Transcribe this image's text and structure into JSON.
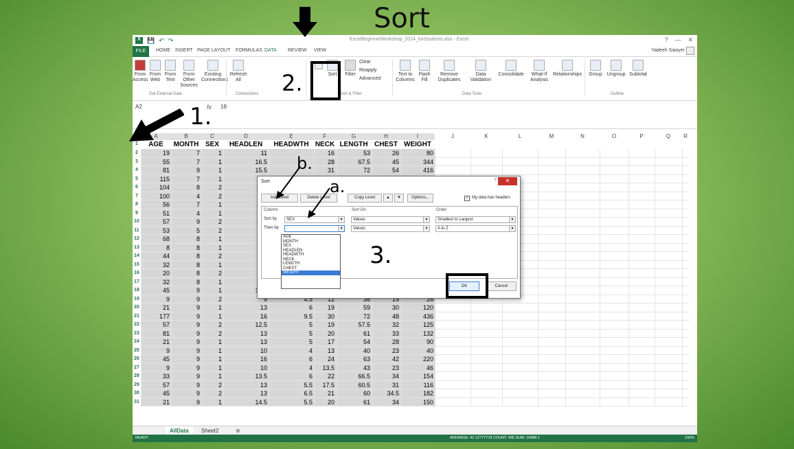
{
  "slide": {
    "title": "Sort"
  },
  "excel": {
    "title": "ExcelBeginnerWorkshop_2014_forStudents.xlsx - Excel",
    "user": "Yadeeh Sawyer",
    "tabs": [
      "FILE",
      "HOME",
      "INSERT",
      "PAGE LAYOUT",
      "FORMULAS",
      "DATA",
      "REVIEW",
      "VIEW"
    ],
    "ribbon": {
      "from_access": "From Access",
      "from_web": "From Web",
      "from_text": "From Text",
      "from_other": "From Other Sources",
      "existing": "Existing Connections",
      "refresh": "Refresh All",
      "sort": "Sort",
      "filter": "Filter",
      "clear": "Clear",
      "reapply": "Reapply",
      "advanced": "Advanced",
      "text_to_columns": "Text to Columns",
      "flash_fill": "Flash Fill",
      "remove_dup": "Remove Duplicates",
      "data_validation": "Data Validation",
      "consolidate": "Consolidate",
      "whatif": "What-If Analysis",
      "relationships": "Relationships",
      "group": "Group",
      "ungroup": "Ungroup",
      "subtotal": "Subtotal",
      "grp_external": "Get External Data",
      "grp_connections": "Connections",
      "grp_sort": "Sort & Filter",
      "grp_tools": "Data Tools",
      "grp_outline": "Outline"
    },
    "namebox": "A2",
    "fx": "fx",
    "formula": "19",
    "columns": [
      "A",
      "B",
      "C",
      "D",
      "E",
      "F",
      "G",
      "H",
      "I",
      "J",
      "K",
      "L",
      "M",
      "N",
      "O",
      "P",
      "Q",
      "R"
    ],
    "headers": [
      "AGE",
      "MONTH",
      "SEX",
      "HEADLEN",
      "HEADWTH",
      "NECK",
      "LENGTH",
      "CHEST",
      "WEIGHT"
    ],
    "rows": [
      [
        "19",
        "7",
        "1",
        "11",
        "",
        "16",
        "53",
        "26",
        "80"
      ],
      [
        "55",
        "7",
        "1",
        "16.5",
        "",
        "28",
        "67.5",
        "45",
        "344"
      ],
      [
        "81",
        "9",
        "1",
        "15.5",
        "",
        "31",
        "72",
        "54",
        "416"
      ],
      [
        "115",
        "7",
        "1",
        "",
        "",
        "",
        "",
        "",
        ""
      ],
      [
        "104",
        "8",
        "2",
        "15",
        "",
        "",
        "",
        "",
        ""
      ],
      [
        "100",
        "4",
        "2",
        "",
        "",
        "",
        "",
        "",
        ""
      ],
      [
        "56",
        "7",
        "1",
        "",
        "",
        "",
        "",
        "",
        ""
      ],
      [
        "51",
        "4",
        "1",
        "13",
        "",
        "",
        "",
        "",
        ""
      ],
      [
        "57",
        "9",
        "2",
        "13",
        "",
        "",
        "",
        "",
        ""
      ],
      [
        "53",
        "5",
        "2",
        "12",
        "",
        "",
        "",
        "",
        ""
      ],
      [
        "68",
        "8",
        "1",
        "",
        "",
        "",
        "",
        "",
        ""
      ],
      [
        "8",
        "8",
        "1",
        "",
        "",
        "",
        "",
        "",
        ""
      ],
      [
        "44",
        "8",
        "2",
        "12",
        "",
        "",
        "",
        "",
        ""
      ],
      [
        "32",
        "8",
        "1",
        "",
        "",
        "",
        "",
        "",
        ""
      ],
      [
        "20",
        "8",
        "2",
        "11",
        "",
        "",
        "",
        "",
        ""
      ],
      [
        "32",
        "8",
        "1",
        "",
        "",
        "",
        "",
        "",
        ""
      ],
      [
        "45",
        "9",
        "1",
        "13.5",
        "7",
        "24",
        "64",
        "39",
        "204"
      ],
      [
        "9",
        "9",
        "2",
        "9",
        "4.5",
        "12",
        "36",
        "19",
        "26"
      ],
      [
        "21",
        "9",
        "1",
        "13",
        "6",
        "19",
        "59",
        "30",
        "120"
      ],
      [
        "177",
        "9",
        "1",
        "16",
        "9.5",
        "30",
        "72",
        "48",
        "436"
      ],
      [
        "57",
        "9",
        "2",
        "12.5",
        "5",
        "19",
        "57.5",
        "32",
        "125"
      ],
      [
        "81",
        "9",
        "2",
        "13",
        "5",
        "20",
        "61",
        "33",
        "132"
      ],
      [
        "21",
        "9",
        "1",
        "13",
        "5",
        "17",
        "54",
        "28",
        "90"
      ],
      [
        "9",
        "9",
        "1",
        "10",
        "4",
        "13",
        "40",
        "23",
        "40"
      ],
      [
        "45",
        "9",
        "1",
        "16",
        "6",
        "24",
        "63",
        "42",
        "220"
      ],
      [
        "9",
        "9",
        "1",
        "10",
        "4",
        "13.5",
        "43",
        "23",
        "46"
      ],
      [
        "33",
        "9",
        "1",
        "13.5",
        "6",
        "22",
        "66.5",
        "34",
        "154"
      ],
      [
        "57",
        "9",
        "2",
        "13",
        "5.5",
        "17.5",
        "60.5",
        "31",
        "116"
      ],
      [
        "45",
        "9",
        "2",
        "13",
        "6.5",
        "21",
        "60",
        "34.5",
        "182"
      ],
      [
        "21",
        "9",
        "1",
        "14.5",
        "5.5",
        "20",
        "61",
        "34",
        "150"
      ]
    ],
    "sheets": [
      "AllData",
      "Sheet2"
    ],
    "status": {
      "ready": "READY",
      "summary": "AVERAGE: 41.12777778    COUNT: 495    SUM: 19988.1",
      "zoom": "100%"
    }
  },
  "dialog": {
    "title": "Sort",
    "help": "?",
    "close": "✕",
    "add_level": "Add Level",
    "delete_level": "Delete Level",
    "copy_level": "Copy Level",
    "options": "Options...",
    "headers_label": "My data has headers",
    "col_column": "Column",
    "col_sorton": "Sort On",
    "col_order": "Order",
    "sort_by": "Sort by",
    "then_by": "Then by",
    "sort_by_value": "SEX",
    "sort_on_value": "Values",
    "order_value": "Smallest to Largest",
    "then_sort_on": "Values",
    "then_order": "A to Z",
    "list": [
      "AGE",
      "MONTH",
      "SEX",
      "HEADLEN",
      "HEADWTH",
      "NECK",
      "LENGTH",
      "CHEST",
      "WEIGHT"
    ],
    "ok": "OK",
    "cancel": "Cancel"
  },
  "annotations": {
    "step1": "1.",
    "step2": "2.",
    "step3": "3.",
    "a": "a.",
    "b": "b."
  }
}
